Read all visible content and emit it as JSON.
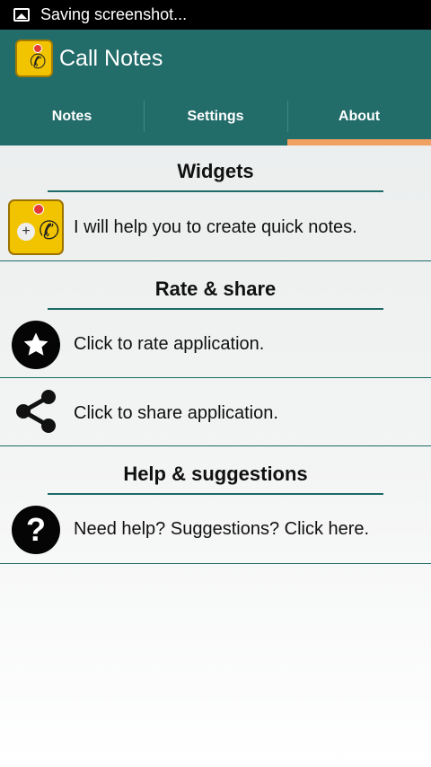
{
  "status_bar": {
    "text": "Saving screenshot..."
  },
  "app": {
    "title": "Call Notes"
  },
  "tabs": [
    {
      "label": "Notes"
    },
    {
      "label": "Settings"
    },
    {
      "label": "About"
    }
  ],
  "active_tab": "About",
  "sections": {
    "widgets": {
      "title": "Widgets",
      "item": "I will help you to create quick notes."
    },
    "rate_share": {
      "title": "Rate & share",
      "rate_item": "Click to rate application.",
      "share_item": "Click to share application."
    },
    "help": {
      "title": "Help & suggestions",
      "item": "Need help? Suggestions? Click here."
    }
  },
  "colors": {
    "primary": "#226c6a",
    "accent": "#f0a060",
    "status_bar": "#000000"
  }
}
